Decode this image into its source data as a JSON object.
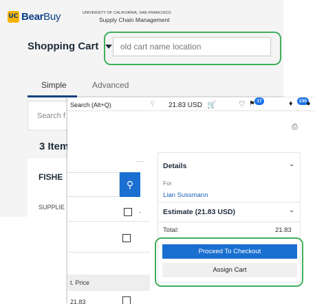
{
  "background_page": {
    "logo": {
      "badge": "UC",
      "bold": "Bear",
      "light": "Buy"
    },
    "university": "UNIVERSITY OF CALIFORNIA, SAN FRANCISCO",
    "department": "Supply Chain Management",
    "cart_title": "Shopping Cart",
    "cart_name_placeholder": "old cart name location",
    "tabs": [
      "Simple",
      "Advanced"
    ],
    "search_placeholder": "Search f",
    "items_title": "3 Item",
    "supplier_name": "FISHE",
    "supplier_label": "SUPPLIE"
  },
  "overlay_page": {
    "search_placeholder": "Search (Alt+Q)",
    "cart_amount": "21.83 USD",
    "favorites_badge": "17",
    "notifications_badge": "230",
    "more_dots": "...",
    "checkbox_dash": "-",
    "price_header": "t. Price",
    "price_value": "21.83",
    "details": {
      "title": "Details",
      "for_label": "For",
      "for_name": "Lian Sussmann",
      "estimate_title": "Estimate (21.83 USD)",
      "total_label": "Total:",
      "total_value": "21.83",
      "checkout_button": "Proceed To Checkout",
      "assign_button": "Assign Cart"
    }
  },
  "colors": {
    "brand_blue": "#0a3f82",
    "primary_button": "#1a6fd1",
    "highlight_green": "#3fae5a",
    "badge_blue": "#1a73e8"
  },
  "icons": [
    "uc-logo-icon",
    "chevron-down-icon",
    "search-icon",
    "cart-icon",
    "heart-icon",
    "flag-icon",
    "bell-icon",
    "user-icon",
    "printer-icon"
  ]
}
